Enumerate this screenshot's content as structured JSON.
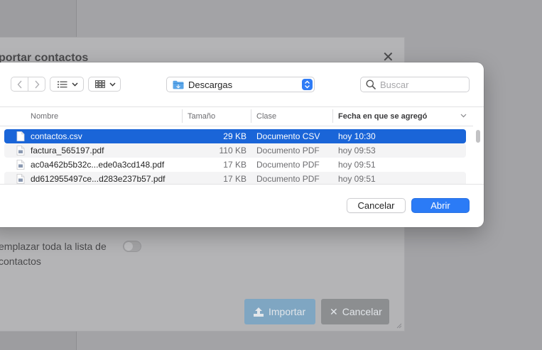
{
  "background": {
    "modal_title": "portar contactos",
    "close_glyph": "✕",
    "replace_label": "emplazar toda la lista de contactos",
    "import_button": "Importar",
    "cancel_button": "Cancelar",
    "cancel_glyph": "✕"
  },
  "dialog": {
    "location": "Descargas",
    "search": {
      "placeholder": "Buscar",
      "value": ""
    },
    "columns": {
      "name": "Nombre",
      "size": "Tamaño",
      "kind": "Clase",
      "date": "Fecha en que se agregó"
    },
    "files": [
      {
        "name": "contactos.csv",
        "size": "29 KB",
        "kind": "Documento CSV",
        "date": "hoy 10:30",
        "selected": true
      },
      {
        "name": "factura_565197.pdf",
        "size": "110 KB",
        "kind": "Documento PDF",
        "date": "hoy 09:53"
      },
      {
        "name": "ac0a462b5b32c...ede0a3cd148.pdf",
        "size": "17 KB",
        "kind": "Documento PDF",
        "date": "hoy 09:51"
      },
      {
        "name": "dd612955497ce...d283e237b57.pdf",
        "size": "17 KB",
        "kind": "Documento PDF",
        "date": "hoy 09:51"
      }
    ],
    "buttons": {
      "cancel": "Cancelar",
      "open": "Abrir"
    }
  },
  "colors": {
    "accent": "#2b7bf6",
    "selection": "#1a65d8",
    "folder_icon": "#5aa5e8"
  },
  "icons": [
    "back-icon",
    "forward-icon",
    "list-view-icon",
    "grid-view-icon",
    "chevron-down-icon",
    "folder-icon",
    "stepper-icon",
    "search-icon",
    "file-icon",
    "pdf-file-icon",
    "upload-icon",
    "close-icon",
    "resize-grip-icon"
  ]
}
